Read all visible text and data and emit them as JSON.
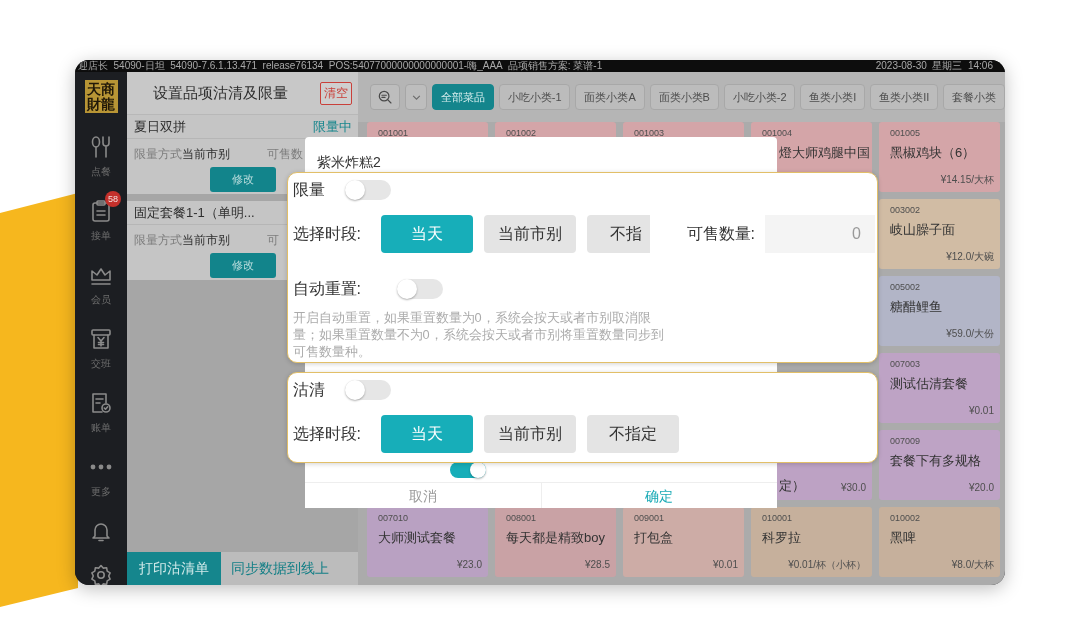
{
  "status_bar": {
    "info": "迎店长  54090-日坦  54090-7.6.1.13.471  release76134  POS:54077000000000000001-嗨_AAA  品项销售方案: 菜谱-1",
    "datetime": "2023-08-30  星期三  14:06"
  },
  "sidebar": {
    "logo": "天商財龍",
    "items": [
      {
        "kind": "order",
        "label": "点餐"
      },
      {
        "kind": "orders",
        "label": "接单",
        "badge": "58"
      },
      {
        "kind": "member",
        "label": "会员"
      },
      {
        "kind": "shift",
        "label": "交班"
      },
      {
        "kind": "bill",
        "label": "账单"
      },
      {
        "kind": "more",
        "label": "更多"
      },
      {
        "kind": "bell"
      },
      {
        "kind": "settings"
      }
    ]
  },
  "left_panel": {
    "title": "设置品项沽清及限量",
    "clear_button": "清空",
    "items": [
      {
        "name": "夏日双拼",
        "status": "限量中",
        "mode_label": "限量方式",
        "mode_value": "当前市别",
        "qty_label": "可售数",
        "edit_button": "修改"
      },
      {
        "name": "固定套餐1-1（单明...",
        "mode_label": "限量方式",
        "mode_value": "当前市别",
        "qty_label": "可",
        "edit_button": "修改"
      }
    ],
    "print_button": "打印沽清单",
    "sync_button": "同步数据到线上"
  },
  "toolbar": {
    "categories": [
      {
        "label": "全部菜品",
        "selected": true
      },
      {
        "label": "小吃小类-1",
        "selected": false
      },
      {
        "label": "面类小类A",
        "selected": false
      },
      {
        "label": "面类小类B",
        "selected": false
      },
      {
        "label": "小吃小类-2",
        "selected": false
      },
      {
        "label": "鱼类小类I",
        "selected": false
      },
      {
        "label": "鱼类小类II",
        "selected": false
      },
      {
        "label": "套餐小类",
        "selected": false
      }
    ]
  },
  "dishes": [
    {
      "kind": "head",
      "code": "001001",
      "color": "#d4a5a8"
    },
    {
      "kind": "head",
      "code": "001002",
      "color": "#d4a5a8"
    },
    {
      "kind": "head",
      "code": "001003",
      "color": "#d4a5a8"
    },
    {
      "kind": "head",
      "code": "001004",
      "name": "燈大师鸡腿中国",
      "color": "#d4a5a8"
    },
    {
      "kind": "full",
      "code": "001005",
      "name": "黑椒鸡块（6）",
      "price": "¥14.15/大杯",
      "color": "#d4a5a8"
    },
    {
      "kind": "full",
      "code": "003002",
      "name": "岐山臊子面",
      "price": "¥12.0/大碗",
      "color": "#d1bca4"
    },
    {
      "kind": "full",
      "code": "005002",
      "name": "糖醋鲤鱼",
      "price": "¥59.0/大份",
      "color": "#b2b5c7"
    },
    {
      "kind": "full",
      "code": "007003",
      "name": "测试估清套餐",
      "price": "¥0.01",
      "color": "#bea3c5"
    },
    {
      "kind": "tail",
      "name": "定）",
      "price": "¥30.0",
      "color": "#bda2c4"
    },
    {
      "kind": "full",
      "code": "007009",
      "name": "套餐下有多规格",
      "price": "¥20.0",
      "color": "#bea3c5"
    },
    {
      "kind": "full",
      "code": "007010",
      "name": "大师测试套餐",
      "price": "¥23.0",
      "color": "#b9a1c2"
    },
    {
      "kind": "full",
      "code": "008001",
      "name": "每天都是精致boy",
      "price": "¥28.5",
      "color": "#c9a2a5"
    },
    {
      "kind": "full",
      "code": "009001",
      "name": "打包盒",
      "price": "¥0.01",
      "color": "#cdaca6"
    },
    {
      "kind": "full",
      "code": "010001",
      "name": "科罗拉",
      "price": "¥0.01/杯（小杯）",
      "color": "#c6b09c"
    },
    {
      "kind": "full",
      "code": "010002",
      "name": "黑啤",
      "price": "¥8.0/大杯",
      "color": "#c6b09c"
    }
  ],
  "dialog": {
    "title": "紫米炸糕2",
    "sync_toggle": {
      "on": true
    },
    "cancel_button": "取消",
    "confirm_button": "确定"
  },
  "highlight_cards": [
    {
      "kind": "limit",
      "label": "限量",
      "on": false,
      "period_label": "选择时段:",
      "periods": [
        {
          "label": "当天",
          "selected": true
        },
        {
          "label": "当前市别",
          "selected": false
        },
        {
          "label": "不指",
          "selected": false
        }
      ],
      "qty_label": "可售数量:",
      "qty_value": "0",
      "reset_label": "自动重置:",
      "reset_on": false,
      "hint": "开启自动重置，如果重置数量为0，系统会按天或者市别取消限量；如果重置数量不为0，系统会按天或者市别将重置数量同步到可售数量种。"
    },
    {
      "kind": "soldout",
      "label": "沽清",
      "on": false,
      "period_label": "选择时段:",
      "periods": [
        {
          "label": "当天",
          "selected": true
        },
        {
          "label": "当前市别",
          "selected": false
        },
        {
          "label": "不指定",
          "selected": false
        }
      ]
    }
  ]
}
